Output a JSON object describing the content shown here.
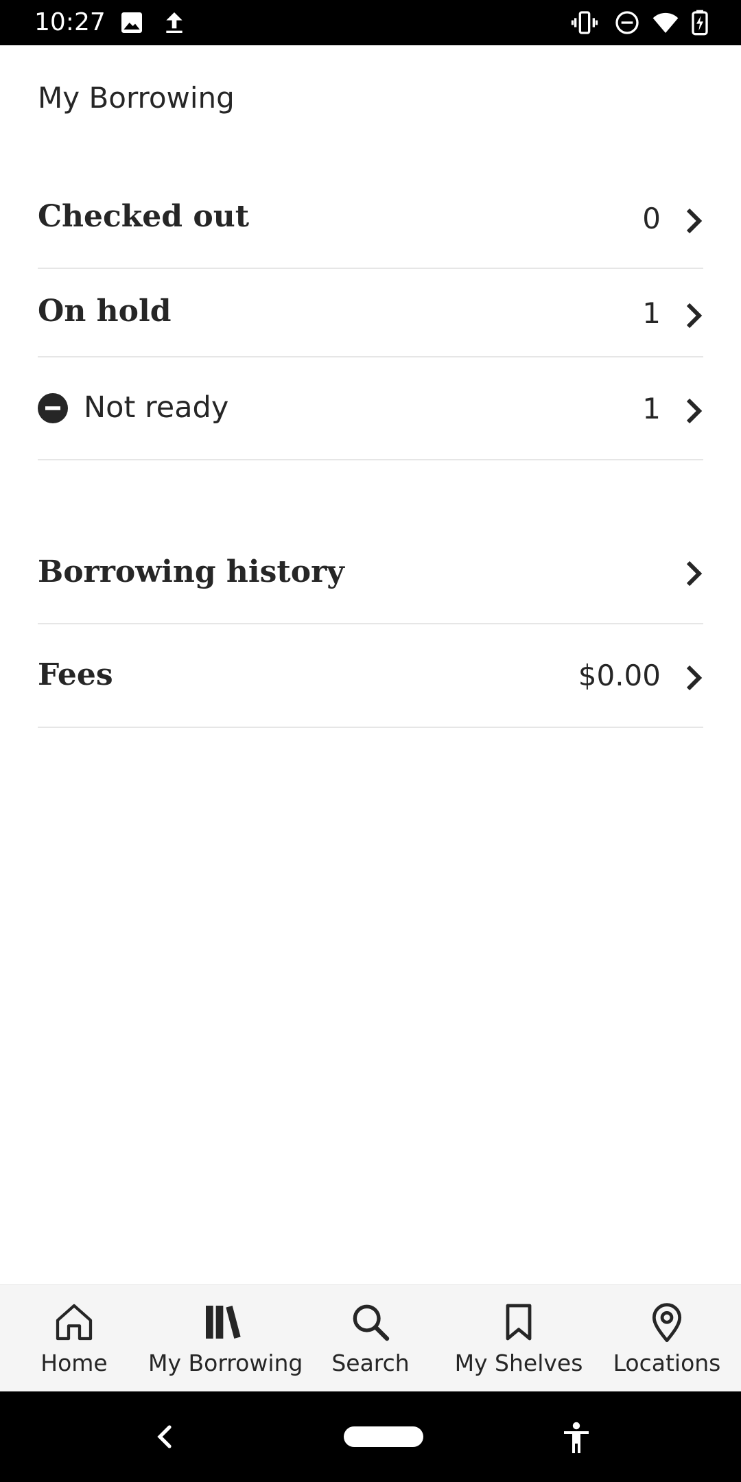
{
  "status_bar": {
    "time": "10:27",
    "left_icons": [
      "image-icon",
      "upload-icon"
    ],
    "right_icons": [
      "vibrate-icon",
      "do-not-disturb-icon",
      "wifi-icon",
      "battery-charging-icon"
    ]
  },
  "page": {
    "title": "My Borrowing"
  },
  "rows": {
    "checked_out": {
      "label": "Checked out",
      "count": "0",
      "icon": "chevron-right-icon"
    },
    "on_hold": {
      "label": "On hold",
      "count": "1",
      "icon": "chevron-right-icon"
    },
    "not_ready": {
      "label": "Not ready",
      "count": "1",
      "status_icon": "minus-circle-icon",
      "icon": "chevron-right-icon"
    },
    "borrowing_history": {
      "label": "Borrowing history",
      "icon": "chevron-right-icon"
    },
    "fees": {
      "label": "Fees",
      "amount": "$0.00",
      "icon": "chevron-right-icon"
    }
  },
  "bottom_nav": {
    "items": [
      {
        "label": "Home",
        "icon": "home-icon"
      },
      {
        "label": "My Borrowing",
        "icon": "books-icon"
      },
      {
        "label": "Search",
        "icon": "search-icon"
      },
      {
        "label": "My Shelves",
        "icon": "bookmark-icon"
      },
      {
        "label": "Locations",
        "icon": "location-pin-icon"
      }
    ]
  },
  "system_nav": {
    "buttons": [
      "back-icon",
      "home-pill-icon",
      "accessibility-icon"
    ]
  },
  "colors": {
    "text": "#262626",
    "divider": "#e6e6e6",
    "nav_background": "#f5f5f5",
    "system_bar": "#000000"
  }
}
